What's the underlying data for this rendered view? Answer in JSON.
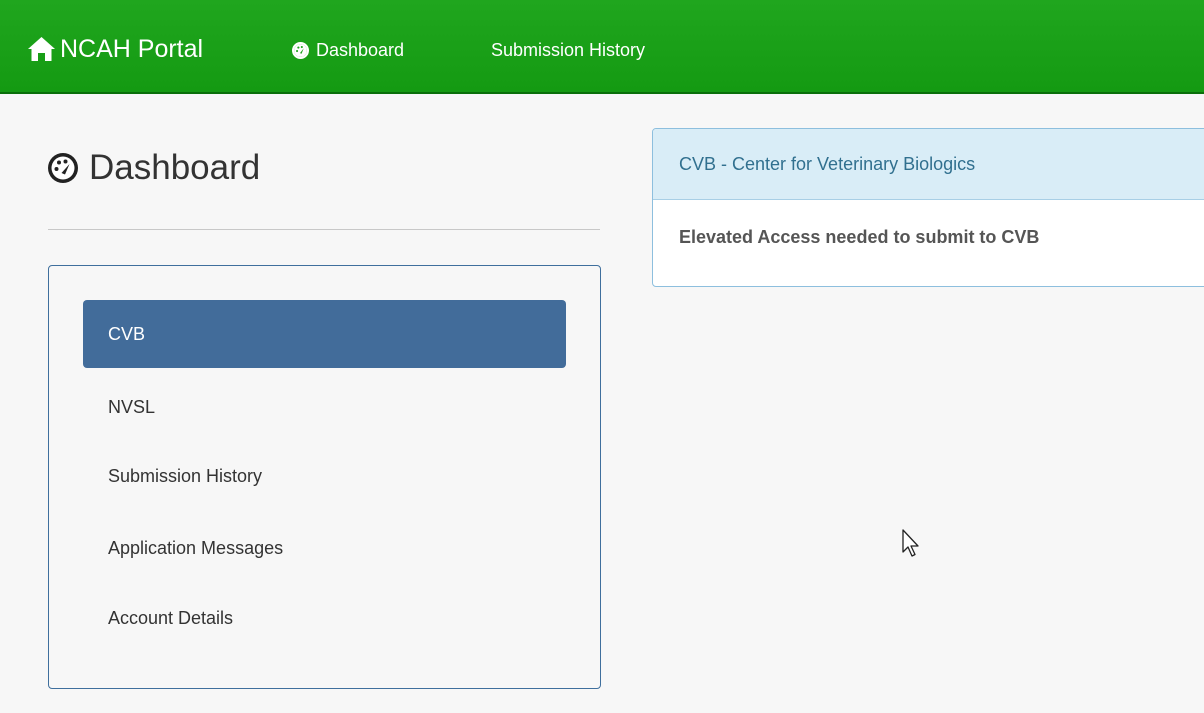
{
  "navbar": {
    "brand": "NCAH Portal",
    "brand_icon": "home-icon",
    "links": [
      {
        "label": "Dashboard",
        "icon": "dashboard-gauge-icon"
      },
      {
        "label": "Submission History"
      }
    ],
    "bg_color": "#1aa318"
  },
  "page": {
    "title": "Dashboard",
    "title_icon": "dashboard-gauge-icon"
  },
  "sidebar": {
    "border_color": "#3f6f9d",
    "active_color": "#426c9a",
    "items": [
      {
        "label": "CVB",
        "active": true
      },
      {
        "label": "NVSL",
        "active": false
      },
      {
        "label": "Submission History",
        "active": false
      },
      {
        "label": "Application Messages",
        "active": false
      },
      {
        "label": "Account Details",
        "active": false
      }
    ]
  },
  "info_panel": {
    "heading": "CVB - Center for Veterinary Biologics",
    "body": "Elevated Access needed to submit to CVB",
    "heading_bg": "#d9edf7",
    "heading_color": "#31708f"
  }
}
